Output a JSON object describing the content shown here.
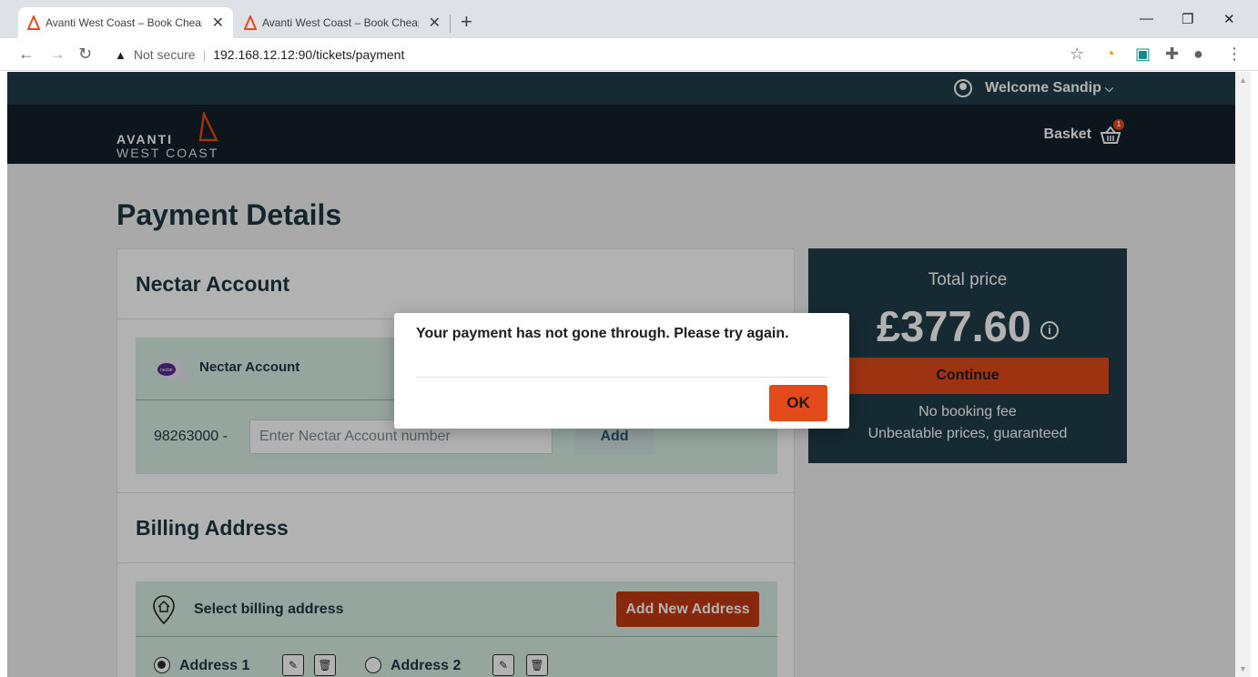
{
  "browser": {
    "tabs": [
      {
        "title": "Avanti West Coast – Book Cheap"
      },
      {
        "title": "Avanti West Coast – Book Cheap"
      }
    ],
    "security_label": "Not secure",
    "url": "192.168.12.12:90/tickets/payment",
    "icons": [
      "back-icon",
      "forward-icon",
      "reload-icon",
      "star-icon",
      "extension-icon",
      "profile-icon",
      "menu-icon"
    ]
  },
  "site": {
    "welcome": "Welcome Sandip",
    "logo_line1": "AVANTI",
    "logo_line2": "WEST COAST",
    "basket_label": "Basket",
    "basket_count": "1",
    "brand_color": "#e24a1b",
    "header_color": "#13202a",
    "accent_teal": "#1f3d48"
  },
  "page": {
    "title": "Payment Details",
    "nectar": {
      "section_title": "Nectar Account",
      "box_label": "Nectar Account",
      "prefix": "98263000 -",
      "input_placeholder": "Enter Nectar Account number",
      "add_label": "Add"
    },
    "billing": {
      "section_title": "Billing Address",
      "select_label": "Select billing address",
      "add_new_label": "Add New Address",
      "addresses": [
        {
          "label": "Address 1",
          "selected": true
        },
        {
          "label": "Address 2",
          "selected": false
        }
      ]
    },
    "summary": {
      "total_label": "Total price",
      "total_amount": "£377.60",
      "continue_label": "Continue",
      "no_fee": "No booking fee",
      "unbeatable": "Unbeatable prices, guaranteed"
    }
  },
  "dialog": {
    "message": "Your payment has not gone through. Please try again.",
    "ok_label": "OK"
  }
}
